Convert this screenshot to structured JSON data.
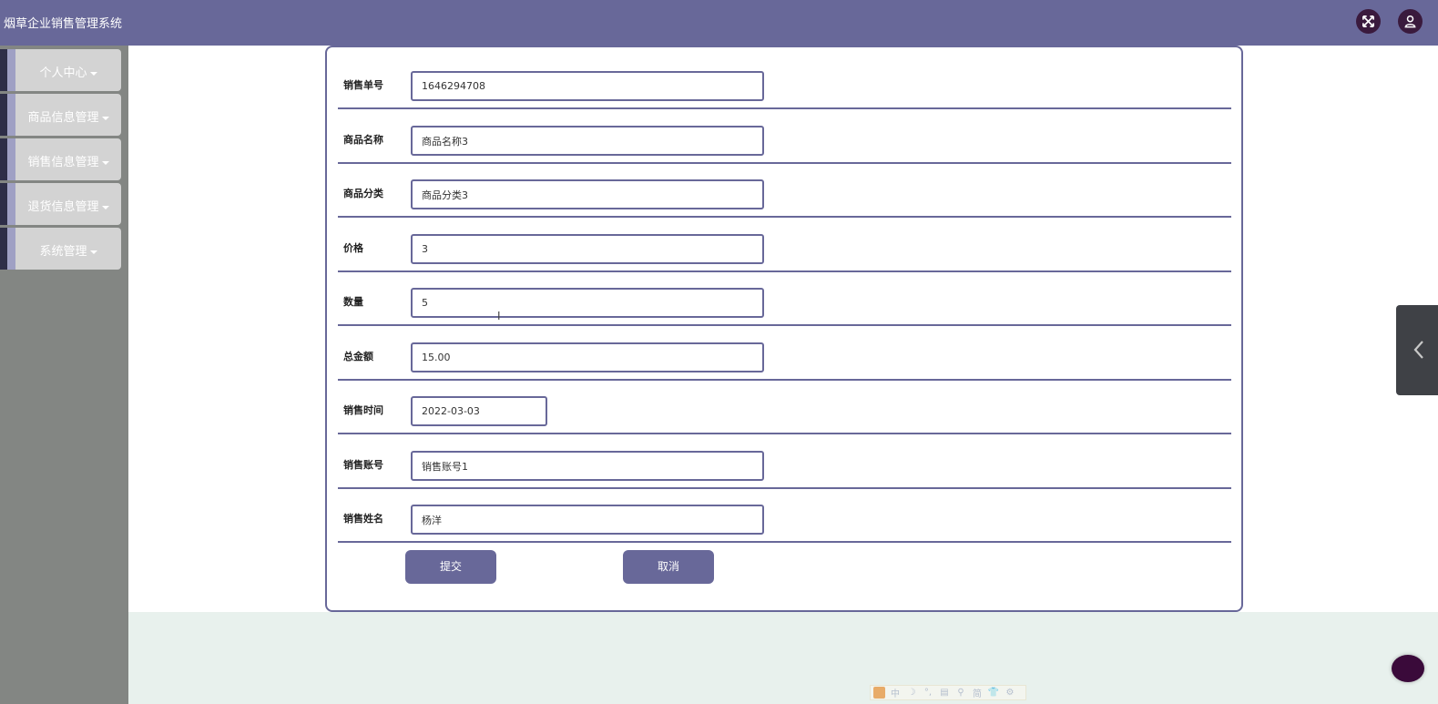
{
  "app": {
    "title": "烟草企业销售管理系统"
  },
  "topbar": {
    "icons": [
      "fullscreen-icon",
      "user-icon"
    ],
    "accent_color": "#686899"
  },
  "sidebar": {
    "items": [
      {
        "label": "个人中心"
      },
      {
        "label": "商品信息管理"
      },
      {
        "label": "销售信息管理"
      },
      {
        "label": "退货信息管理"
      },
      {
        "label": "系统管理"
      }
    ]
  },
  "form": {
    "fields": [
      {
        "label": "销售单号",
        "value": "1646294708"
      },
      {
        "label": "商品名称",
        "value": "商品名称3"
      },
      {
        "label": "商品分类",
        "value": "商品分类3"
      },
      {
        "label": "价格",
        "value": "3"
      },
      {
        "label": "数量",
        "value": "5"
      },
      {
        "label": "总金额",
        "value": "15.00"
      },
      {
        "label": "销售时间",
        "value": "2022-03-03"
      },
      {
        "label": "销售账号",
        "value": "销售账号1"
      },
      {
        "label": "销售姓名",
        "value": "杨洋"
      }
    ],
    "submit_label": "提交",
    "cancel_label": "取消"
  },
  "ime": {
    "cells": [
      "中",
      "☽",
      "°,",
      "▤",
      "⚲",
      "简",
      "👕",
      "⚙"
    ]
  }
}
